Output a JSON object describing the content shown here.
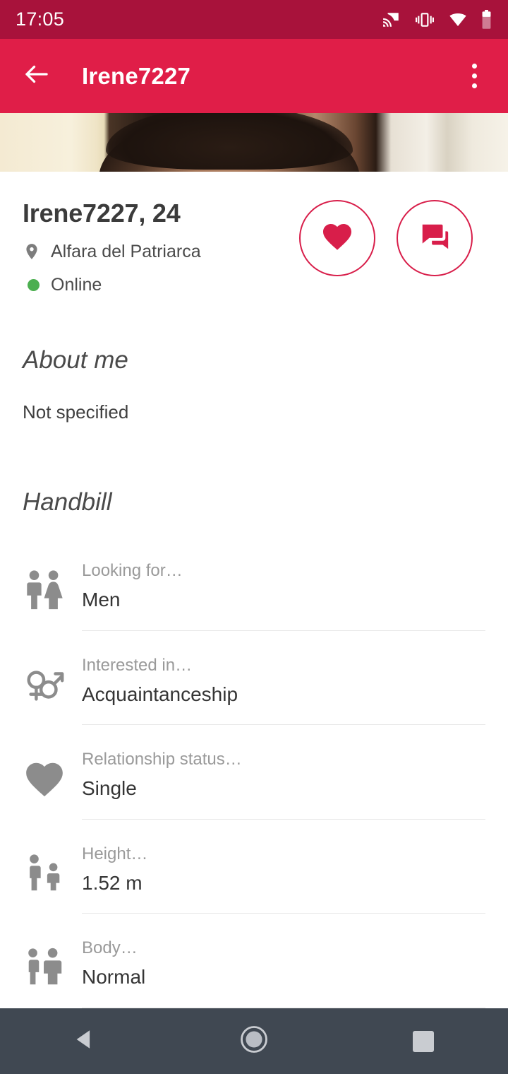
{
  "status_bar": {
    "time": "17:05",
    "icons": [
      "cast-icon",
      "vibrate-icon",
      "wifi-icon",
      "battery-icon"
    ]
  },
  "app_bar": {
    "back_icon": "back-arrow-icon",
    "title": "Irene7227",
    "overflow_icon": "more-vertical-icon"
  },
  "profile": {
    "name_age": "Irene7227, 24",
    "location": "Alfara del Patriarca",
    "location_icon": "location-pin-icon",
    "status": "Online",
    "status_color": "#4caf50",
    "actions": [
      {
        "name": "like-button",
        "icon": "heart-icon"
      },
      {
        "name": "chat-button",
        "icon": "forum-icon"
      }
    ]
  },
  "about": {
    "title": "About me",
    "text": "Not specified"
  },
  "handbill": {
    "title": "Handbill",
    "rows": [
      {
        "icon": "man-woman-icon",
        "label": "Looking for…",
        "value": "Men"
      },
      {
        "icon": "gender-symbols-icon",
        "label": "Interested in…",
        "value": "Acquaintanceship"
      },
      {
        "icon": "heart-filled-icon",
        "label": "Relationship status…",
        "value": "Single"
      },
      {
        "icon": "height-people-icon",
        "label": "Height…",
        "value": "1.52 m"
      },
      {
        "icon": "body-people-icon",
        "label": "Body…",
        "value": "Normal"
      }
    ]
  },
  "nav_bar": {
    "back": "nav-back-icon",
    "home": "nav-home-icon",
    "recents": "nav-recents-icon"
  },
  "colors": {
    "status_bar": "#A8123B",
    "app_bar": "#E01E48",
    "accent": "#D81E4A",
    "online": "#4caf50",
    "nav_bar": "#404852"
  }
}
